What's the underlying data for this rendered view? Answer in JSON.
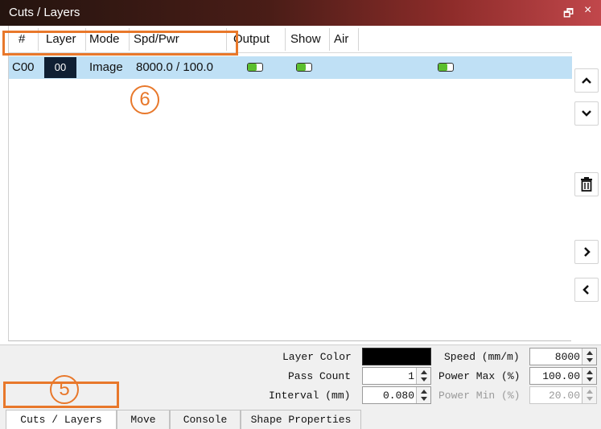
{
  "window": {
    "title": "Cuts / Layers",
    "restore_glyph": "🗗",
    "close_glyph": "×"
  },
  "table": {
    "columns": [
      "#",
      "Layer",
      "Mode",
      "Spd/Pwr",
      "Output",
      "Show",
      "Air"
    ],
    "rows": [
      {
        "id": "C00",
        "layer": "00",
        "mode": "Image",
        "spd_pwr": "8000.0 / 100.0",
        "output": "on",
        "show": "on",
        "air": "on"
      }
    ]
  },
  "annotations": {
    "row_marker": "6",
    "tab_marker": "5"
  },
  "side_buttons": [
    {
      "icon": "chevron-up-icon",
      "glyph": "⌃"
    },
    {
      "icon": "chevron-down-icon",
      "glyph": "⌄"
    },
    {
      "icon": "trash-icon",
      "glyph": "🗑"
    },
    {
      "icon": "chevron-right-icon",
      "glyph": "›"
    },
    {
      "icon": "chevron-left-icon",
      "glyph": "‹"
    }
  ],
  "settings": {
    "layer_color_label": "Layer Color",
    "layer_color": "#000000",
    "pass_count_label": "Pass Count",
    "pass_count": "1",
    "interval_label": "Interval (mm)",
    "interval": "0.080",
    "speed_label": "Speed (mm/m)",
    "speed": "8000",
    "power_max_label": "Power Max (%)",
    "power_max": "100.00",
    "power_min_label": "Power Min (%)",
    "power_min": "20.00"
  },
  "tabs": [
    "Cuts / Layers",
    "Move",
    "Console",
    "Shape Properties"
  ],
  "colors": {
    "accent": "#e8782b",
    "selected_row": "#bfe0f5",
    "toggle_on": "#5bbf2e"
  }
}
